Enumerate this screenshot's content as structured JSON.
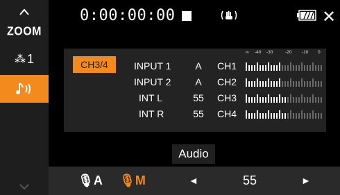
{
  "sidebar": {
    "zoom_label": "ZOOM",
    "effect_label": "1",
    "active_color": "#f28a1e"
  },
  "topbar": {
    "timecode": "0:00:00:00",
    "close_label": "✕"
  },
  "panel": {
    "channel_toggle": "CH3/4",
    "scale": [
      "∞",
      "-40",
      "-30",
      "-20",
      "-10",
      "0"
    ],
    "rows": [
      {
        "input": "INPUT 1",
        "level": "A",
        "channel": "CH1",
        "meter_level": 0.45
      },
      {
        "input": "INPUT 2",
        "level": "A",
        "channel": "CH2",
        "meter_level": 0.45
      },
      {
        "input": "INT L",
        "level": "55",
        "channel": "CH3",
        "meter_level": 0.55
      },
      {
        "input": "INT R",
        "level": "55",
        "channel": "CH4",
        "meter_level": 0.55
      }
    ]
  },
  "caption": "Audio",
  "bottom": {
    "mic_auto": "A",
    "mic_manual": "M",
    "arrow_left": "◄",
    "level_value": "55",
    "arrow_right": "►"
  }
}
